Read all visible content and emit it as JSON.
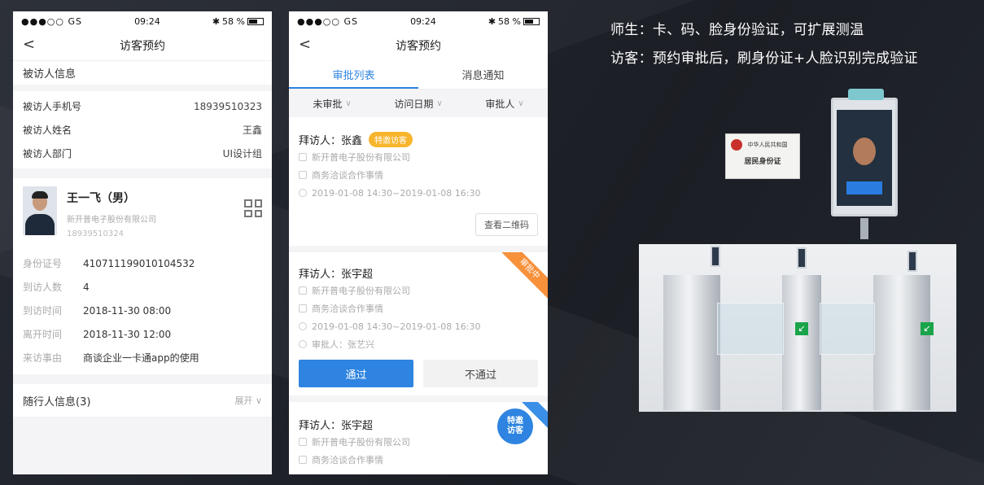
{
  "status_bar": {
    "signal": "●●●○○ GS",
    "wifi": "",
    "time": "09:24",
    "bluetooth": "✱",
    "battery": "58 %"
  },
  "phone1": {
    "nav_title": "访客预约",
    "host_section_title": "被访人信息",
    "host_rows": [
      {
        "label": "被访人手机号",
        "value": "18939510323"
      },
      {
        "label": "被访人姓名",
        "value": "王鑫"
      },
      {
        "label": "被访人部门",
        "value": "UI设计组"
      }
    ],
    "visitor": {
      "name": "王一飞（男）",
      "company": "新开普电子股份有限公司",
      "phone": "18939510324"
    },
    "visitor_details": [
      {
        "label": "身份证号",
        "value": "410711199010104532"
      },
      {
        "label": "到访人数",
        "value": "4"
      },
      {
        "label": "到访时间",
        "value": "2018-11-30 08:00"
      },
      {
        "label": "离开时间",
        "value": "2018-11-30 12:00"
      },
      {
        "label": "来访事由",
        "value": "商谈企业一卡通app的使用"
      }
    ],
    "companion_label": "随行人信息(3)",
    "companion_expand": "展开 ∨"
  },
  "phone2": {
    "nav_title": "访客预约",
    "tabs": [
      "审批列表",
      "消息通知"
    ],
    "filters": [
      "未审批",
      "访问日期",
      "审批人"
    ],
    "cards": [
      {
        "title": "拜访人：张鑫",
        "badge": "特邀访客",
        "company": "新开普电子股份有限公司",
        "purpose": "商务洽谈合作事情",
        "time": "2019-01-08 14:30~2019-01-08 16:30",
        "qr_button": "查看二维码"
      },
      {
        "title": "拜访人：张宇超",
        "ribbon": "审批中",
        "company": "新开普电子股份有限公司",
        "purpose": "商务洽谈合作事情",
        "time": "2019-01-08 14:30~2019-01-08 16:30",
        "approver": "审批人：张艺兴",
        "pass_button": "通过",
        "fail_button": "不通过"
      },
      {
        "title": "拜访人：张宇超",
        "bubble": "特邀\n访客",
        "company": "新开普电子股份有限公司",
        "purpose": "商务洽谈合作事情"
      }
    ]
  },
  "right_panel": {
    "line1": "师生：卡、码、脸身份验证，可扩展测温",
    "line2": "访客：预约审批后，刷身份证+人脸识别完成验证",
    "idcard_header": "中华人民共和国",
    "idcard_title": "居民身份证"
  },
  "colors": {
    "accent": "#2e84e0",
    "badge": "#f7b52c",
    "ribbon": "#f7913c",
    "background": "#1d2027"
  }
}
